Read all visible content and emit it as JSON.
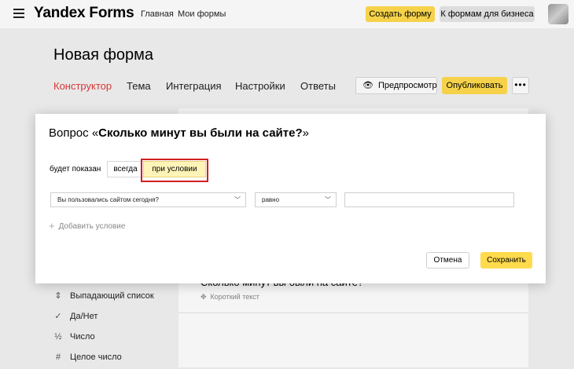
{
  "header": {
    "logo": "Yandex Forms",
    "nav": [
      "Главная",
      "Мои формы"
    ],
    "create_button": "Создать форму",
    "business_button": "К формам для бизнеса"
  },
  "page": {
    "title": "Новая форма",
    "tabs": [
      "Конструктор",
      "Тема",
      "Интеграция",
      "Настройки",
      "Ответы"
    ],
    "active_tab": "Конструктор",
    "preview_button": "Предпросмотр",
    "publish_button": "Опубликовать",
    "more_button": "•••"
  },
  "sidebar": {
    "items": [
      {
        "icon": "updown-icon",
        "glyph": "⇕",
        "label": "Выпадающий список"
      },
      {
        "icon": "check-icon",
        "glyph": "✓",
        "label": "Да/Нет"
      },
      {
        "icon": "fraction-icon",
        "glyph": "½",
        "label": "Число"
      },
      {
        "icon": "hash-icon",
        "glyph": "#",
        "label": "Целое число"
      }
    ]
  },
  "form_card": {
    "question_title": "Сколько минут вы были на сайте?",
    "question_type": "Короткий текст",
    "question_type_glyph": "✥"
  },
  "modal": {
    "title_prefix": "Вопрос «",
    "title_question": "Сколько минут вы были на сайте?",
    "title_suffix": "»",
    "shown_label": "будет показан",
    "option_always": "всегда",
    "option_condition": "при условии",
    "selected_option": "при условии",
    "condition": {
      "question_select": "Вы пользовались сайтом сегодня?",
      "operator_select": "равно",
      "value": ""
    },
    "add_condition": "Добавить условие",
    "cancel_button": "Отмена",
    "save_button": "Сохранить"
  },
  "colors": {
    "accent_yellow": "#ffdb4d",
    "active_tab_red": "#e03a3a",
    "highlight_red": "#d41f1f",
    "selected_option_bg": "#fff4b8"
  }
}
